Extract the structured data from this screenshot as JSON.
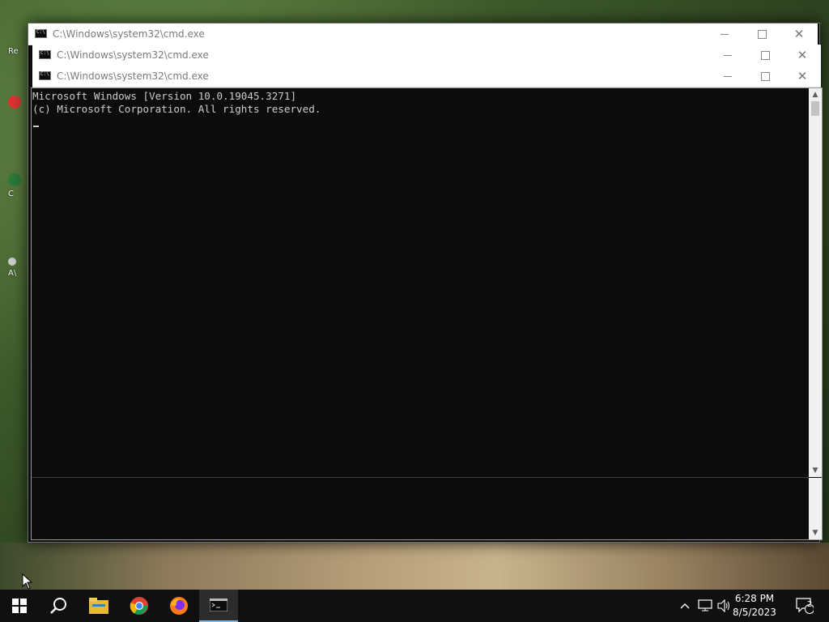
{
  "desktop": {
    "icons": [
      {
        "label": "Re"
      },
      {
        "label": ""
      },
      {
        "label": "C"
      },
      {
        "label": "A\\"
      }
    ]
  },
  "windows": [
    {
      "title": "C:\\Windows\\system32\\cmd.exe"
    },
    {
      "title": "C:\\Windows\\system32\\cmd.exe"
    },
    {
      "title": "C:\\Windows\\system32\\cmd.exe"
    }
  ],
  "console": {
    "lines": "Microsoft Windows [Version 10.0.19045.3271]\n(c) Microsoft Corporation. All rights reserved."
  },
  "taskbar": {
    "apps": [
      "start-icon",
      "search-icon",
      "file-explorer-icon",
      "chrome-icon",
      "firefox-icon",
      "cmd-icon"
    ],
    "accent": "#76b9ed",
    "clock_time": "6:28 PM",
    "clock_date": "8/5/2023",
    "notification_count": "2"
  }
}
